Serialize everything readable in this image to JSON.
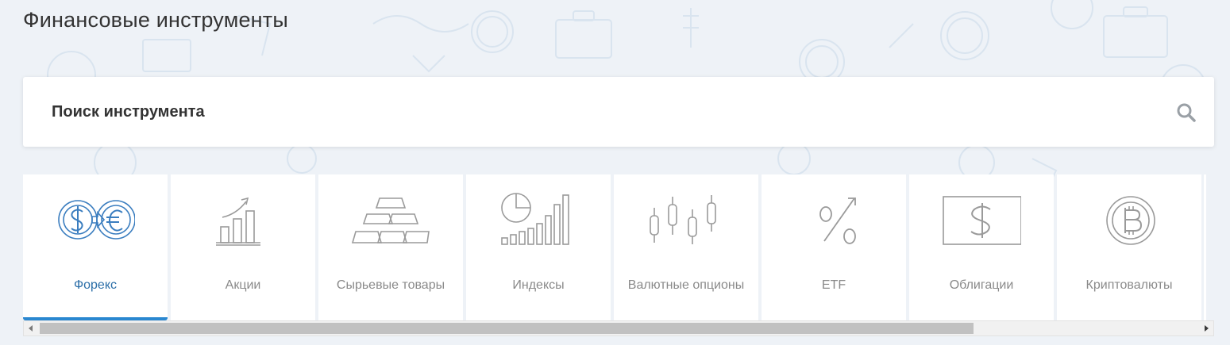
{
  "page": {
    "title": "Финансовые инструменты"
  },
  "search": {
    "placeholder": "Поиск инструмента"
  },
  "tabs": [
    {
      "label": "Форекс",
      "icon": "forex-exchange-icon",
      "active": true
    },
    {
      "label": "Акции",
      "icon": "stock-growth-chart-icon",
      "active": false
    },
    {
      "label": "Сырьевые товары",
      "icon": "gold-bars-icon",
      "active": false
    },
    {
      "label": "Индексы",
      "icon": "index-pie-bar-chart-icon",
      "active": false
    },
    {
      "label": "Валютные опционы",
      "icon": "candlestick-chart-icon",
      "active": false
    },
    {
      "label": "ETF",
      "icon": "percent-arrow-icon",
      "active": false
    },
    {
      "label": "Облигации",
      "icon": "dollar-bill-icon",
      "active": false
    },
    {
      "label": "Криптовалюты",
      "icon": "bitcoin-icon",
      "active": false
    }
  ],
  "colors": {
    "active_text": "#2c6fa8",
    "active_underline": "#2a87d0",
    "inactive_text": "#8a8a8a",
    "icon_active": "#3a7dbf",
    "icon_inactive": "#9a9a9a"
  }
}
